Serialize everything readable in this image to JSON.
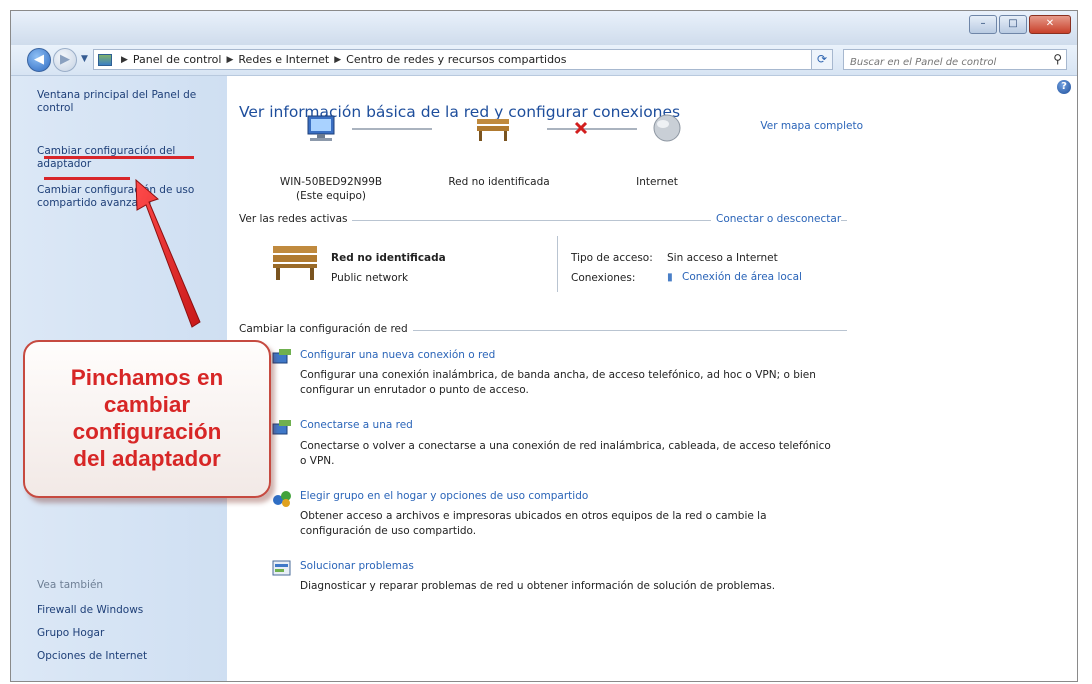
{
  "window": {
    "minimize_label": "–",
    "maximize_label": "□",
    "close_label": "✕"
  },
  "address_bar": {
    "crumbs": [
      "Panel de control",
      "Redes e Internet",
      "Centro de redes y recursos compartidos"
    ]
  },
  "search": {
    "placeholder": "Buscar en el Panel de control"
  },
  "left_pane": {
    "main_link": "Ventana principal del Panel de control",
    "adapter_link_line1": "Cambiar configuración del",
    "adapter_link_line2": "adaptador",
    "sharing_link_line1": "Cambiar configuración de uso",
    "sharing_link_line2": "compartido avanzado",
    "see_also_title": "Vea también",
    "see_also": [
      "Firewall de Windows",
      "Grupo Hogar",
      "Opciones de Internet"
    ]
  },
  "main": {
    "title": "Ver información básica de la red y configurar conexiones",
    "full_map_link": "Ver mapa completo",
    "computer_name": "WIN-50BED92N99B",
    "computer_caption": "(Este equipo)",
    "network_label": "Red no identificada",
    "internet_label": "Internet",
    "active_networks_title": "Ver las redes activas",
    "connect_link": "Conectar o desconectar",
    "active_network_name": "Red no identificada",
    "active_network_type": "Public network",
    "access_type_label": "Tipo de acceso:",
    "access_type_value": "Sin acceso a Internet",
    "connections_label": "Conexiones:",
    "connections_value": "Conexión de área local",
    "change_settings_title": "Cambiar la configuración de red",
    "tasks": [
      {
        "title": "Configurar una nueva conexión o red",
        "desc1": "Configurar una conexión inalámbrica, de banda ancha, de acceso telefónico, ad hoc o VPN; o bien",
        "desc2": "configurar un enrutador o punto de acceso."
      },
      {
        "title": "Conectarse a una red",
        "desc1": "Conectarse o volver a conectarse a una conexión de red inalámbrica, cableada, de acceso telefónico",
        "desc2": "o VPN."
      },
      {
        "title": "Elegir grupo en el hogar y opciones de uso compartido",
        "desc1": "Obtener acceso a archivos e impresoras ubicados en otros equipos de la red o cambie la",
        "desc2": "configuración de uso compartido."
      },
      {
        "title": "Solucionar problemas",
        "desc1": "Diagnosticar y reparar problemas de red u obtener información de solución de problemas.",
        "desc2": ""
      }
    ]
  },
  "callout": {
    "line1": "Pinchamos en",
    "line2": "cambiar",
    "line3": "configuración",
    "line4": "del adaptador"
  },
  "colors": {
    "callout_text": "#d72626",
    "annotation_red": "#d8262a",
    "link_blue": "#2a64b8",
    "nav_pane": "#d6e4f4"
  }
}
